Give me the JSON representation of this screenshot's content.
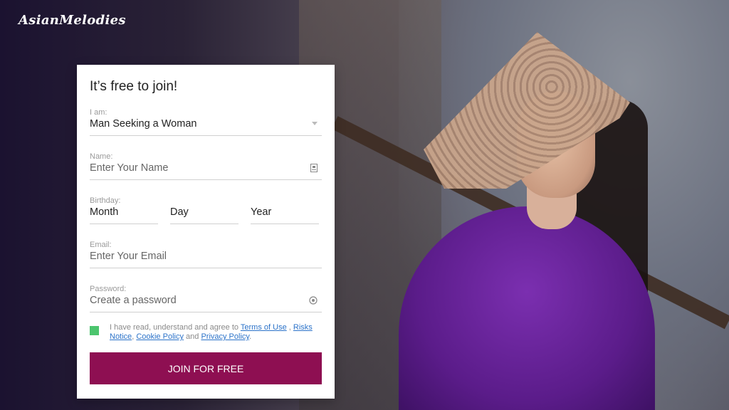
{
  "brand": {
    "logo": "AsianMelodies"
  },
  "form": {
    "title": "It’s free to join!",
    "iam_label": "I am:",
    "iam_value": "Man Seeking a Woman",
    "name_label": "Name:",
    "name_placeholder": "Enter Your Name",
    "birthday_label": "Birthday:",
    "month": "Month",
    "day": "Day",
    "year": "Year",
    "email_label": "Email:",
    "email_placeholder": "Enter Your Email",
    "password_label": "Password:",
    "password_placeholder": "Create a password",
    "terms_prefix": "I have read, understand and agree to",
    "terms_link": "Terms of Use",
    "comma": ",",
    "risks_link": "Risks Notice",
    "cookie_link": "Cookie Policy",
    "and": "and",
    "privacy_link": "Privacy Policy",
    "period": ".",
    "join_button": "JOIN FOR FREE"
  },
  "colors": {
    "join_button": "#8e0f52",
    "checkbox": "#4cc56e",
    "link": "#2c73c9"
  },
  "icons": {
    "select_arrow": "chevron-down-icon",
    "name_field": "id-card-icon",
    "password_field": "eye-icon"
  }
}
